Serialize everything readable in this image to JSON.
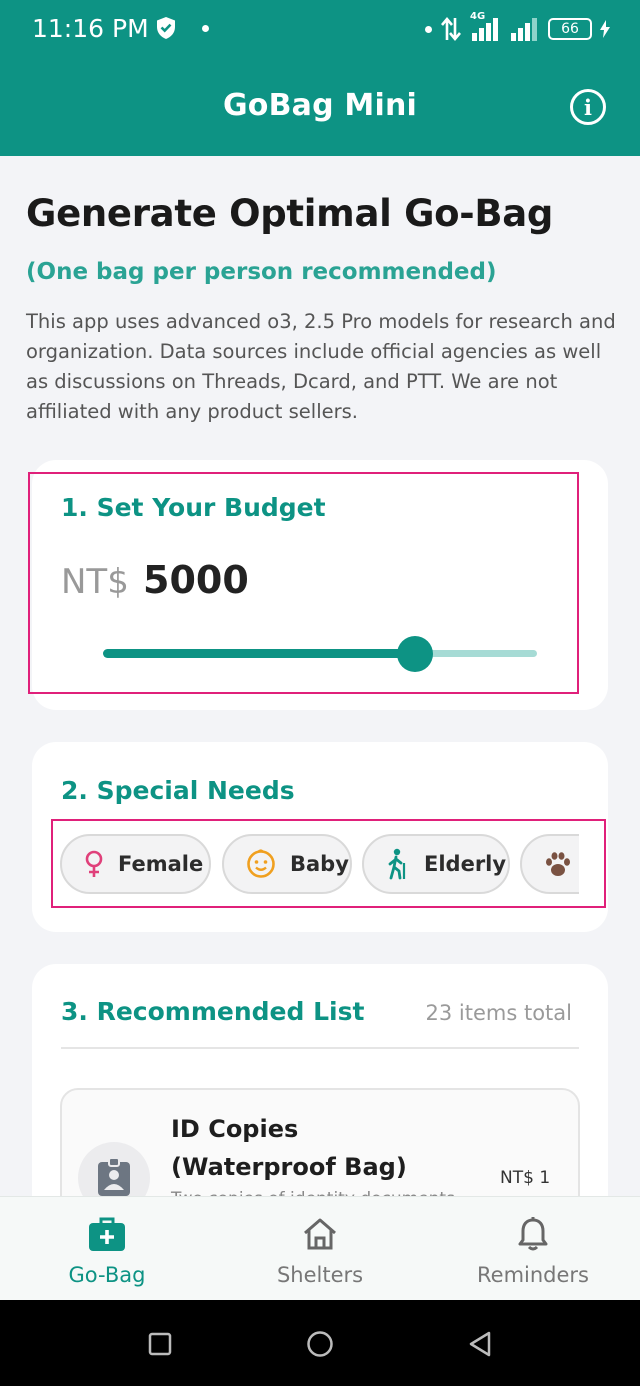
{
  "status_bar": {
    "time": "11:16 PM",
    "network": "4G",
    "battery": "66",
    "color": "#0d9384"
  },
  "app_bar": {
    "title": "GoBag Mini",
    "info_icon": "info-circle-icon"
  },
  "intro": {
    "title": "Generate Optimal Go-Bag",
    "subtitle": "(One bag per person recommended)",
    "description": "This app uses advanced o3, 2.5 Pro models for research and organization. Data sources include official agencies as well as discussions on Threads, Dcard, and PTT. We are not affiliated with any product sellers."
  },
  "budget": {
    "heading": "1. Set Your Budget",
    "currency": "NT$",
    "value": "5000",
    "slider_fraction": 0.72
  },
  "special_needs": {
    "heading": "2. Special Needs",
    "chips": [
      {
        "label": "Female",
        "icon": "female-symbol-icon"
      },
      {
        "label": "Baby",
        "icon": "baby-face-icon"
      },
      {
        "label": "Elderly",
        "icon": "elderly-walking-icon"
      },
      {
        "label": "",
        "icon": "paw-icon"
      }
    ]
  },
  "recommended": {
    "heading": "3. Recommended List",
    "count": "23 items total",
    "items": [
      {
        "name": "ID Copies (Waterproof Bag)",
        "price": "NT$ 1",
        "description": "Two copies of identity documents",
        "icon": "id-badge-icon"
      }
    ]
  },
  "bottom_nav": {
    "items": [
      {
        "label": "Go-Bag",
        "icon": "medical-bag-icon",
        "active": true
      },
      {
        "label": "Shelters",
        "icon": "home-icon",
        "active": false
      },
      {
        "label": "Reminders",
        "icon": "bell-icon",
        "active": false
      }
    ]
  },
  "colors": {
    "accent": "#0d9384",
    "accent_light": "#2aa394",
    "highlight_box": "#e0207a"
  }
}
